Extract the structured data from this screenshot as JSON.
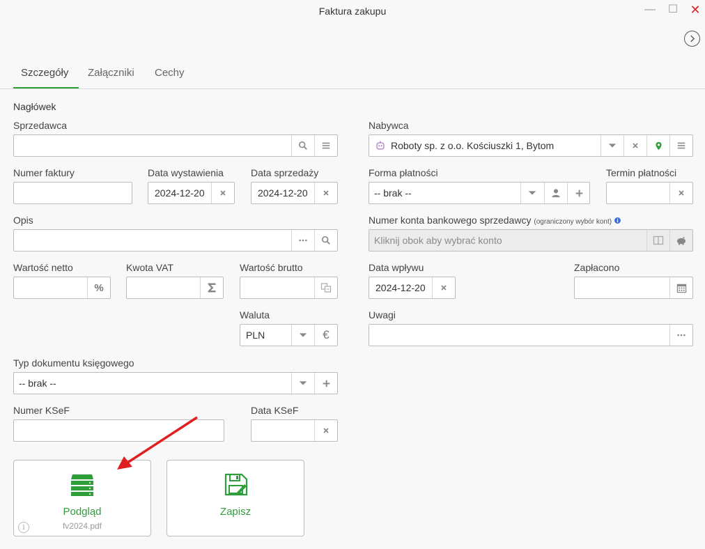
{
  "window": {
    "title": "Faktura zakupu",
    "minimize": "—",
    "maximize": "☐",
    "close": "✕"
  },
  "tabs": [
    {
      "label": "Szczegóły",
      "active": true
    },
    {
      "label": "Załączniki",
      "active": false
    },
    {
      "label": "Cechy",
      "active": false
    }
  ],
  "section_title": "Nagłówek",
  "fields": {
    "sprzedawca": {
      "label": "Sprzedawca",
      "value": ""
    },
    "nabywca": {
      "label": "Nabywca",
      "value": "Roboty sp. z o.o. Kościuszki 1, Bytom"
    },
    "numer_faktury": {
      "label": "Numer faktury",
      "value": ""
    },
    "data_wystawienia": {
      "label": "Data wystawienia",
      "value": "2024-12-20"
    },
    "data_sprzedazy": {
      "label": "Data sprzedaży",
      "value": "2024-12-20"
    },
    "forma_platnosci": {
      "label": "Forma płatności",
      "value": "-- brak --"
    },
    "termin_platnosci": {
      "label": "Termin płatności",
      "value": ""
    },
    "opis": {
      "label": "Opis",
      "value": ""
    },
    "numer_konta": {
      "label": "Numer konta bankowego sprzedawcy",
      "note": "(ograniczony wybór kont)",
      "placeholder": "Kliknij obok aby wybrać konto"
    },
    "wartosc_netto": {
      "label": "Wartość netto",
      "value": ""
    },
    "kwota_vat": {
      "label": "Kwota VAT",
      "value": ""
    },
    "wartosc_brutto": {
      "label": "Wartość brutto",
      "value": ""
    },
    "data_wplywu": {
      "label": "Data wpływu",
      "value": "2024-12-20"
    },
    "zaplacono": {
      "label": "Zapłacono",
      "value": ""
    },
    "waluta": {
      "label": "Waluta",
      "value": "PLN"
    },
    "uwagi": {
      "label": "Uwagi",
      "value": ""
    },
    "typ_dokumentu": {
      "label": "Typ dokumentu księgowego",
      "value": "-- brak --"
    },
    "numer_ksef": {
      "label": "Numer KSeF",
      "value": ""
    },
    "data_ksef": {
      "label": "Data KSeF",
      "value": ""
    }
  },
  "buttons": {
    "podglad": {
      "label": "Podgląd",
      "file": "fv2024.pdf"
    },
    "zapisz": {
      "label": "Zapisz"
    }
  },
  "colors": {
    "accent_green": "#2e9e3b",
    "close_red": "#d9252a",
    "annotation_arrow": "#e02020"
  }
}
